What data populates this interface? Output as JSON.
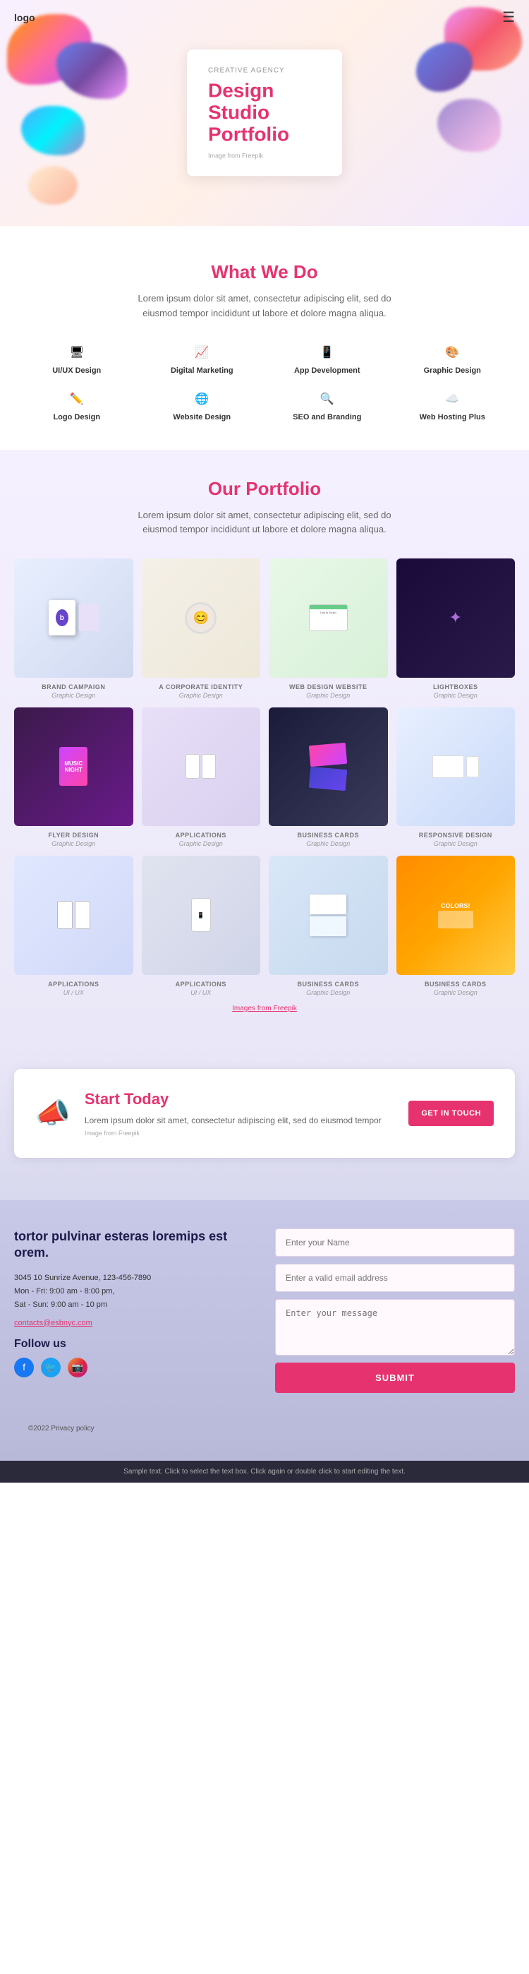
{
  "header": {
    "logo": "logo",
    "hamburger_icon": "☰"
  },
  "hero": {
    "agency_label": "CREATIVE AGENCY",
    "title_line1": "Design",
    "title_line2": "Studio",
    "title_line3": "Portfolio",
    "img_credit": "Image from Freepik"
  },
  "what_we_do": {
    "section_title": "What We Do",
    "description": "Lorem ipsum dolor sit amet, consectetur adipiscing elit, sed do eiusmod tempor incididunt ut labore et dolore magna aliqua.",
    "services": [
      {
        "icon": "🖥",
        "label": "UI/UX Design"
      },
      {
        "icon": "📈",
        "label": "Digital Marketing"
      },
      {
        "icon": "📱",
        "label": "App Development"
      },
      {
        "icon": "🎨",
        "label": "Graphic Design"
      },
      {
        "icon": "✏️",
        "label": "Logo Design"
      },
      {
        "icon": "🌐",
        "label": "Website Design"
      },
      {
        "icon": "🔍",
        "label": "SEO and Branding"
      },
      {
        "icon": "☁️",
        "label": "Web Hosting Plus"
      }
    ]
  },
  "portfolio": {
    "section_title": "Our Portfolio",
    "description": "Lorem ipsum dolor sit amet, consectetur adipiscing elit, sed do eiusmod tempor incididunt ut labore et dolore magna aliqua.",
    "items": [
      {
        "category": "BRAND CAMPAIGN",
        "sub": "Graphic Design",
        "thumb_class": "thumb-brand"
      },
      {
        "category": "A CORPORATE IDENTITY",
        "sub": "Graphic Design",
        "thumb_class": "thumb-corporate"
      },
      {
        "category": "WEB DESIGN WEBSITE",
        "sub": "Graphic Design",
        "thumb_class": "thumb-webdesign"
      },
      {
        "category": "LIGHTBOXES",
        "sub": "Graphic Design",
        "thumb_class": "thumb-lightboxes"
      },
      {
        "category": "FLYER DESIGN",
        "sub": "Graphic Design",
        "thumb_class": "thumb-flyer"
      },
      {
        "category": "APPLICATIONS",
        "sub": "Graphic Design",
        "thumb_class": "thumb-apps"
      },
      {
        "category": "BUSINESS CARDS",
        "sub": "Graphic Design",
        "thumb_class": "thumb-bizcard"
      },
      {
        "category": "RESPONSIVE DESIGN",
        "sub": "Graphic Design",
        "thumb_class": "thumb-responsive"
      },
      {
        "category": "APPLICATIONS",
        "sub": "UI / UX",
        "thumb_class": "thumb-apps2"
      },
      {
        "category": "APPLICATIONS",
        "sub": "UI / UX",
        "thumb_class": "thumb-apps3"
      },
      {
        "category": "BUSINESS CARDS",
        "sub": "Graphic Design",
        "thumb_class": "thumb-bizcard2"
      },
      {
        "category": "BUSINESS CARDS",
        "sub": "Graphic Design",
        "thumb_class": "thumb-bizcard3"
      }
    ],
    "img_credit": "Images from Freepik"
  },
  "start_today": {
    "title": "Start Today",
    "description": "Lorem ipsum dolor sit amet, consectetur adipiscing elit, sed do eiusmod tempor",
    "img_note": "Image from Freepik",
    "cta_label": "GET IN TOUCH"
  },
  "contact": {
    "tagline": "tortor pulvinar esteras loremips est orem.",
    "address_line1": "3045 10 Sunrize Avenue, 123-456-7890",
    "hours_line1": "Mon - Fri: 9:00 am - 8:00 pm,",
    "hours_line2": "Sat - Sun: 9:00 am - 10 pm",
    "email": "contacts@esbnyc.com",
    "follow_label": "Follow us",
    "form": {
      "name_placeholder": "Enter your Name",
      "email_placeholder": "Enter a valid email address",
      "message_placeholder": "Enter your message",
      "submit_label": "SUBMIT"
    }
  },
  "footer": {
    "copyright": "©2022 Privacy policy",
    "bottom_bar_text": "Sample text. Click to select the text box. Click again or double click to start editing the text."
  }
}
